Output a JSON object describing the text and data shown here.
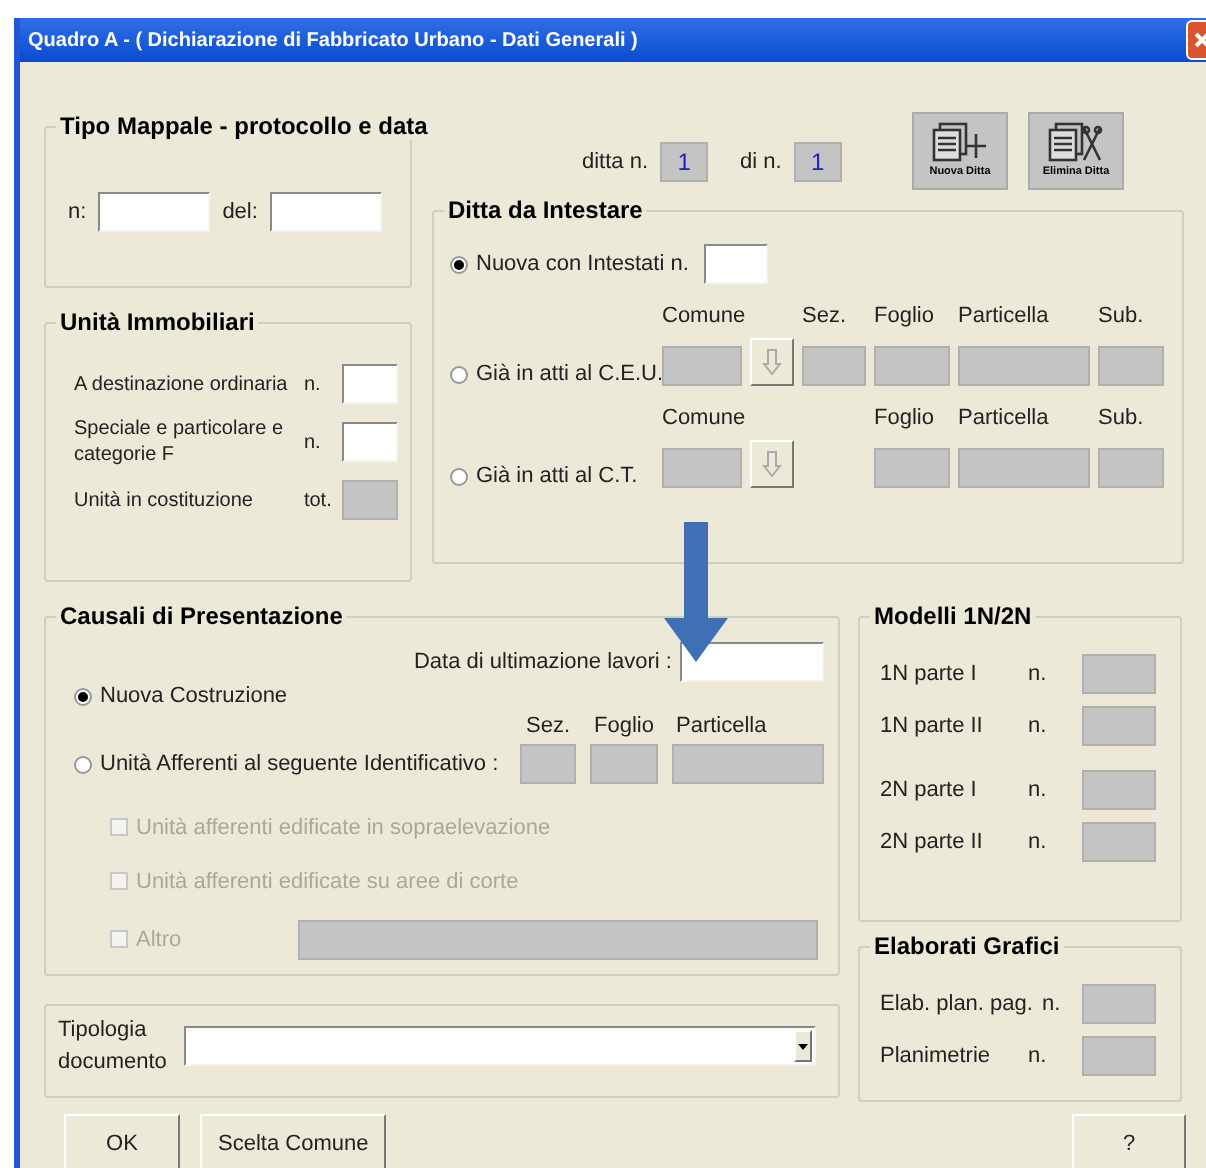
{
  "window": {
    "title": "Quadro A - ( Dichiarazione di Fabbricato Urbano - Dati Generali )"
  },
  "tipo_mappale": {
    "title": "Tipo Mappale - protocollo e data",
    "fields": [
      {
        "label": "n:",
        "disabled": false
      },
      {
        "label": "del:",
        "disabled": false
      }
    ]
  },
  "ditta_counter": {
    "ditta_label": "ditta n.",
    "ditta_value": "1",
    "total_label": "di n.",
    "total_value": "1"
  },
  "toolbar": [
    {
      "label": "Nuova Ditta",
      "kind": "add"
    },
    {
      "label": "Elimina Ditta",
      "kind": "delete"
    }
  ],
  "ditta_da_intestare": {
    "title": "Ditta da Intestare",
    "options": [
      {
        "kind": "count",
        "label": "Nuova con Intestati  n.",
        "selected": true
      },
      {
        "kind": "ceu",
        "label": "Già in atti al C.E.U.",
        "selected": false,
        "fields": [
          {
            "kind": "comune",
            "label": "Comune"
          },
          {
            "kind": "sez",
            "label": "Sez."
          },
          {
            "kind": "foglio",
            "label": "Foglio"
          },
          {
            "kind": "particella",
            "label": "Particella"
          },
          {
            "kind": "sub",
            "label": "Sub."
          }
        ]
      },
      {
        "kind": "ct",
        "label": "Già in atti al C.T.",
        "selected": false,
        "fields": [
          {
            "kind": "comune",
            "label": "Comune"
          },
          {
            "kind": "foglio",
            "label": "Foglio"
          },
          {
            "kind": "particella",
            "label": "Particella"
          },
          {
            "kind": "sub",
            "label": "Sub."
          }
        ]
      }
    ]
  },
  "unita_immobiliari": {
    "title": "Unità Immobiliari",
    "rows": [
      {
        "label": "A destinazione ordinaria",
        "unit": "n.",
        "disabled": false
      },
      {
        "label": "Speciale e particolare e categorie F",
        "unit": "n.",
        "disabled": false
      },
      {
        "label": "Unità in costituzione",
        "unit": "tot.",
        "disabled": true
      }
    ]
  },
  "causali": {
    "title": "Causali di Presentazione",
    "date_label": "Data di ultimazione lavori :",
    "options": [
      {
        "label": "Nuova Costruzione",
        "selected": true
      },
      {
        "label": "Unità Afferenti al seguente Identificativo  :",
        "selected": false
      }
    ],
    "identificativo": [
      {
        "label": "Sez."
      },
      {
        "label": "Foglio"
      },
      {
        "label": "Particella"
      }
    ],
    "checks": [
      {
        "kind": "plain",
        "label": "Unità afferenti edificate in sopraelevazione",
        "checked": false,
        "disabled": true
      },
      {
        "kind": "plain",
        "label": "Unità afferenti edificate su aree di corte",
        "checked": false,
        "disabled": true
      },
      {
        "kind": "with-field",
        "label": "Altro",
        "checked": false,
        "disabled": true
      }
    ]
  },
  "modelli": {
    "title": "Modelli 1N/2N",
    "rows": [
      {
        "label": "1N parte I",
        "unit": "n."
      },
      {
        "label": "1N parte II",
        "unit": "n."
      },
      {
        "label": "2N parte I",
        "unit": "n."
      },
      {
        "label": "2N parte II",
        "unit": "n."
      }
    ]
  },
  "elaborati": {
    "title": "Elaborati Grafici",
    "rows": [
      {
        "label": "Elab. plan. pag.",
        "unit": "n."
      },
      {
        "label": "Planimetrie",
        "unit": "n."
      }
    ]
  },
  "tipologia": {
    "label": "Tipologia documento"
  },
  "buttons": [
    {
      "label": "OK",
      "kind": "left"
    },
    {
      "label": "Scelta Comune",
      "kind": "left"
    },
    {
      "label": "?",
      "kind": "right"
    }
  ]
}
